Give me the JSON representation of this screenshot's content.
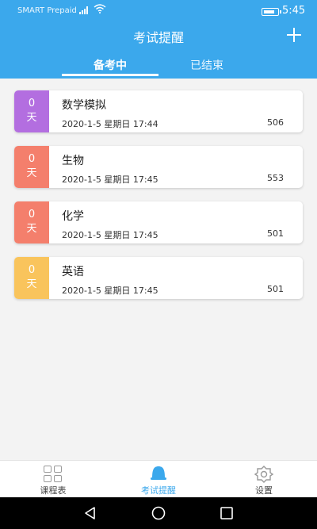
{
  "status_bar": {
    "carrier": "SMART Prepaid",
    "time": "5:45",
    "battery_level": 0.8
  },
  "header": {
    "title": "考试提醒",
    "add_icon": "plus-icon"
  },
  "tabs": [
    {
      "label": "备考中",
      "active": true
    },
    {
      "label": "已结束",
      "active": false
    }
  ],
  "exams": [
    {
      "days": "0",
      "unit": "天",
      "name": "数学模拟",
      "date": "2020-1-5 星期日 17:44",
      "count": "506",
      "color": "#b36ee0"
    },
    {
      "days": "0",
      "unit": "天",
      "name": "生物",
      "date": "2020-1-5 星期日 17:45",
      "count": "553",
      "color": "#f47f6c"
    },
    {
      "days": "0",
      "unit": "天",
      "name": "化学",
      "date": "2020-1-5 星期日 17:45",
      "count": "501",
      "color": "#f47f6c"
    },
    {
      "days": "0",
      "unit": "天",
      "name": "英语",
      "date": "2020-1-5 星期日 17:45",
      "count": "501",
      "color": "#f9c45c"
    }
  ],
  "bottom_nav": [
    {
      "label": "课程表",
      "icon": "grid-icon",
      "active": false
    },
    {
      "label": "考试提醒",
      "icon": "bell-icon",
      "active": true
    },
    {
      "label": "设置",
      "icon": "gear-icon",
      "active": false
    }
  ],
  "system_nav": [
    "back-icon",
    "home-icon",
    "recents-icon"
  ],
  "colors": {
    "primary": "#3ba8ec",
    "background": "#f3f3f3"
  }
}
